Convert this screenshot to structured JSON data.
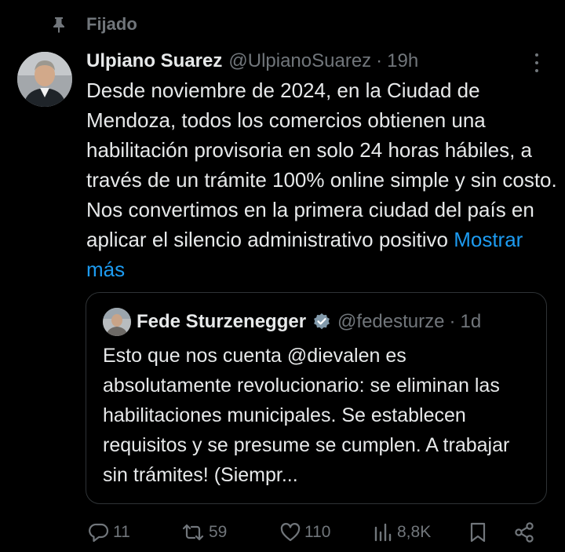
{
  "pinned": {
    "label": "Fijado"
  },
  "post": {
    "author_name": "Ulpiano Suarez",
    "author_handle": "@UlpianoSuarez",
    "separator": "·",
    "time": "19h",
    "text": "Desde noviembre de 2024, en la Ciudad de Mendoza, todos los comercios obtienen una habilitación provisoria en solo 24 horas hábiles, a través de un trámite 100% online simple y sin costo. Nos convertimos en la primera ciudad del país en aplicar el silencio administrativo positivo ",
    "show_more": "Mostrar más"
  },
  "quote": {
    "author_name": "Fede Sturzenegger",
    "author_handle": "@fedesturze",
    "separator": "·",
    "time": "1d",
    "text": "Esto que nos cuenta @dievalen es absolutamente revolucionario: se eliminan las habilitaciones municipales. Se establecen requisitos y se presume se cumplen. A trabajar sin trámites! (Siempr..."
  },
  "actions": {
    "replies": "11",
    "reposts": "59",
    "likes": "110",
    "views": "8,8K"
  },
  "colors": {
    "background": "#000000",
    "text": "#e7e9ea",
    "secondary": "#71767b",
    "link": "#1d9bf0",
    "border": "#2f3336"
  }
}
